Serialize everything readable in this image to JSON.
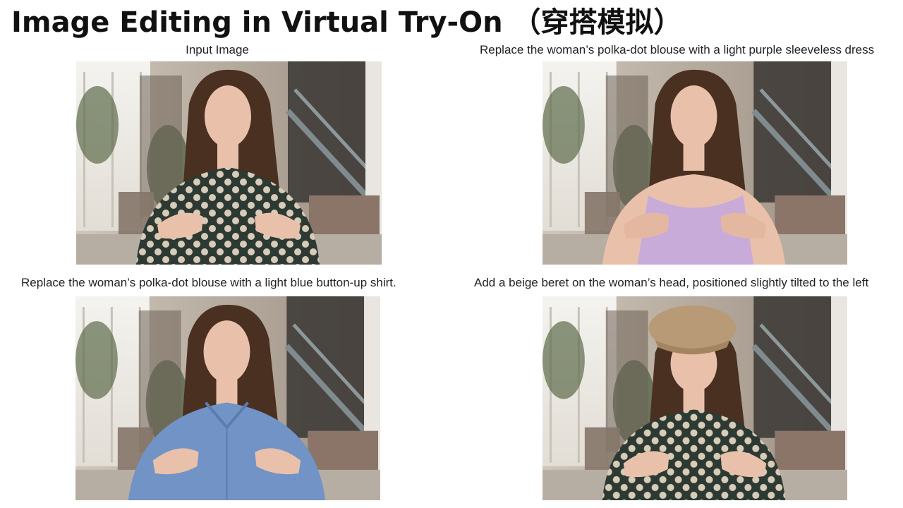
{
  "title": "Image Editing in Virtual Try-On （穿搭模拟）",
  "panels": [
    {
      "caption": "Input Image",
      "outfit": "polka-dot-blouse",
      "colors": {
        "garment": "#2d3a33",
        "dots": "#d8cbb8"
      }
    },
    {
      "caption": "Replace the woman’s polka-dot blouse with a light purple sleeveless dress",
      "outfit": "sleeveless-dress",
      "colors": {
        "garment": "#c9abd9"
      }
    },
    {
      "caption": "Replace the woman’s polka-dot blouse with a light blue button-up shirt.",
      "outfit": "button-up-shirt",
      "colors": {
        "garment": "#7193c6"
      }
    },
    {
      "caption": "Add a beige beret on the woman’s head, positioned slightly tilted to the left",
      "outfit": "polka-dot-blouse-with-beret",
      "colors": {
        "garment": "#2d3a33",
        "dots": "#d8cbb8",
        "beret": "#b89a76"
      }
    }
  ],
  "colors": {
    "background": "#ffffff",
    "title": "#111111",
    "caption": "#222222",
    "hair": "#4a3020",
    "skin": "#e9c1aa"
  }
}
